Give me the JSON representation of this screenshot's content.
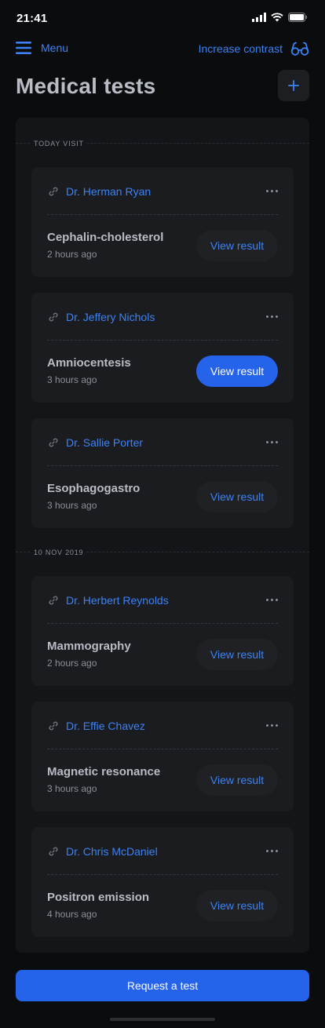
{
  "status_bar": {
    "time": "21:41"
  },
  "nav": {
    "menu_label": "Menu",
    "contrast_label": "Increase contrast"
  },
  "page": {
    "title": "Medical tests"
  },
  "sections": [
    {
      "label": "TODAY VISIT",
      "cards": [
        {
          "doctor": "Dr. Herman Ryan",
          "test": "Cephalin-cholesterol",
          "time": "2 hours ago",
          "button": "View result",
          "active": false
        },
        {
          "doctor": "Dr. Jeffery Nichols",
          "test": "Amniocentesis",
          "time": "3 hours ago",
          "button": "View result",
          "active": true
        },
        {
          "doctor": "Dr. Sallie Porter",
          "test": "Esophagogastro",
          "time": "3 hours ago",
          "button": "View result",
          "active": false
        }
      ]
    },
    {
      "label": "10 NOV 2019",
      "cards": [
        {
          "doctor": "Dr. Herbert Reynolds",
          "test": "Mammography",
          "time": "2 hours ago",
          "button": "View result",
          "active": false
        },
        {
          "doctor": "Dr. Effie Chavez",
          "test": "Magnetic resonance",
          "time": "3 hours ago",
          "button": "View result",
          "active": false
        },
        {
          "doctor": "Dr. Chris McDaniel",
          "test": "Positron emission",
          "time": "4 hours ago",
          "button": "View result",
          "active": false
        }
      ]
    }
  ],
  "footer": {
    "request_label": "Request a test"
  },
  "icons": {
    "menu": "menu-icon",
    "contrast": "glasses-icon",
    "add": "plus-icon",
    "link": "link-icon",
    "more": "more-icon"
  },
  "colors": {
    "accent": "#3b82f6",
    "primary_button": "#2563eb",
    "background": "#0b0c0e",
    "panel": "#141518",
    "card": "#1b1c20"
  }
}
